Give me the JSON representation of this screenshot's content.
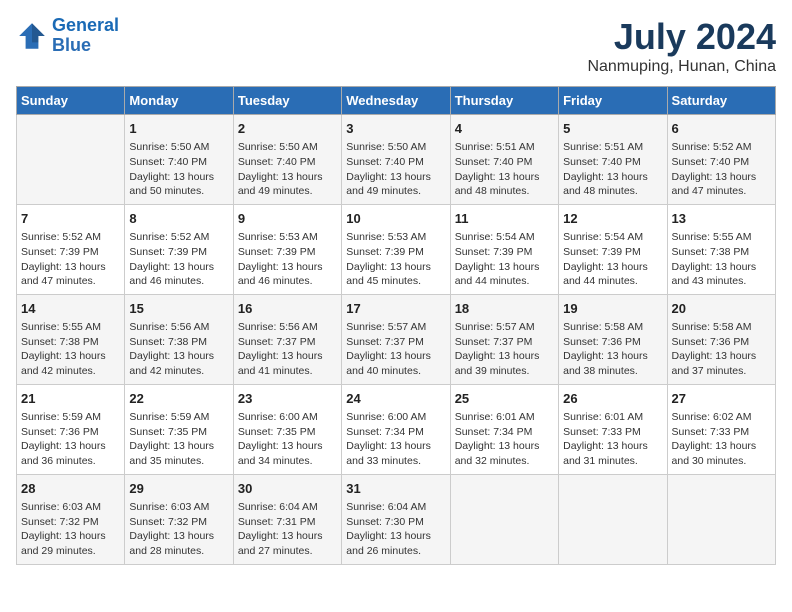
{
  "logo": {
    "text_general": "General",
    "text_blue": "Blue"
  },
  "title": "July 2024",
  "subtitle": "Nanmuping, Hunan, China",
  "days_header": [
    "Sunday",
    "Monday",
    "Tuesday",
    "Wednesday",
    "Thursday",
    "Friday",
    "Saturday"
  ],
  "weeks": [
    [
      {
        "day": "",
        "text": ""
      },
      {
        "day": "1",
        "text": "Sunrise: 5:50 AM\nSunset: 7:40 PM\nDaylight: 13 hours\nand 50 minutes."
      },
      {
        "day": "2",
        "text": "Sunrise: 5:50 AM\nSunset: 7:40 PM\nDaylight: 13 hours\nand 49 minutes."
      },
      {
        "day": "3",
        "text": "Sunrise: 5:50 AM\nSunset: 7:40 PM\nDaylight: 13 hours\nand 49 minutes."
      },
      {
        "day": "4",
        "text": "Sunrise: 5:51 AM\nSunset: 7:40 PM\nDaylight: 13 hours\nand 48 minutes."
      },
      {
        "day": "5",
        "text": "Sunrise: 5:51 AM\nSunset: 7:40 PM\nDaylight: 13 hours\nand 48 minutes."
      },
      {
        "day": "6",
        "text": "Sunrise: 5:52 AM\nSunset: 7:40 PM\nDaylight: 13 hours\nand 47 minutes."
      }
    ],
    [
      {
        "day": "7",
        "text": "Sunrise: 5:52 AM\nSunset: 7:39 PM\nDaylight: 13 hours\nand 47 minutes."
      },
      {
        "day": "8",
        "text": "Sunrise: 5:52 AM\nSunset: 7:39 PM\nDaylight: 13 hours\nand 46 minutes."
      },
      {
        "day": "9",
        "text": "Sunrise: 5:53 AM\nSunset: 7:39 PM\nDaylight: 13 hours\nand 46 minutes."
      },
      {
        "day": "10",
        "text": "Sunrise: 5:53 AM\nSunset: 7:39 PM\nDaylight: 13 hours\nand 45 minutes."
      },
      {
        "day": "11",
        "text": "Sunrise: 5:54 AM\nSunset: 7:39 PM\nDaylight: 13 hours\nand 44 minutes."
      },
      {
        "day": "12",
        "text": "Sunrise: 5:54 AM\nSunset: 7:39 PM\nDaylight: 13 hours\nand 44 minutes."
      },
      {
        "day": "13",
        "text": "Sunrise: 5:55 AM\nSunset: 7:38 PM\nDaylight: 13 hours\nand 43 minutes."
      }
    ],
    [
      {
        "day": "14",
        "text": "Sunrise: 5:55 AM\nSunset: 7:38 PM\nDaylight: 13 hours\nand 42 minutes."
      },
      {
        "day": "15",
        "text": "Sunrise: 5:56 AM\nSunset: 7:38 PM\nDaylight: 13 hours\nand 42 minutes."
      },
      {
        "day": "16",
        "text": "Sunrise: 5:56 AM\nSunset: 7:37 PM\nDaylight: 13 hours\nand 41 minutes."
      },
      {
        "day": "17",
        "text": "Sunrise: 5:57 AM\nSunset: 7:37 PM\nDaylight: 13 hours\nand 40 minutes."
      },
      {
        "day": "18",
        "text": "Sunrise: 5:57 AM\nSunset: 7:37 PM\nDaylight: 13 hours\nand 39 minutes."
      },
      {
        "day": "19",
        "text": "Sunrise: 5:58 AM\nSunset: 7:36 PM\nDaylight: 13 hours\nand 38 minutes."
      },
      {
        "day": "20",
        "text": "Sunrise: 5:58 AM\nSunset: 7:36 PM\nDaylight: 13 hours\nand 37 minutes."
      }
    ],
    [
      {
        "day": "21",
        "text": "Sunrise: 5:59 AM\nSunset: 7:36 PM\nDaylight: 13 hours\nand 36 minutes."
      },
      {
        "day": "22",
        "text": "Sunrise: 5:59 AM\nSunset: 7:35 PM\nDaylight: 13 hours\nand 35 minutes."
      },
      {
        "day": "23",
        "text": "Sunrise: 6:00 AM\nSunset: 7:35 PM\nDaylight: 13 hours\nand 34 minutes."
      },
      {
        "day": "24",
        "text": "Sunrise: 6:00 AM\nSunset: 7:34 PM\nDaylight: 13 hours\nand 33 minutes."
      },
      {
        "day": "25",
        "text": "Sunrise: 6:01 AM\nSunset: 7:34 PM\nDaylight: 13 hours\nand 32 minutes."
      },
      {
        "day": "26",
        "text": "Sunrise: 6:01 AM\nSunset: 7:33 PM\nDaylight: 13 hours\nand 31 minutes."
      },
      {
        "day": "27",
        "text": "Sunrise: 6:02 AM\nSunset: 7:33 PM\nDaylight: 13 hours\nand 30 minutes."
      }
    ],
    [
      {
        "day": "28",
        "text": "Sunrise: 6:03 AM\nSunset: 7:32 PM\nDaylight: 13 hours\nand 29 minutes."
      },
      {
        "day": "29",
        "text": "Sunrise: 6:03 AM\nSunset: 7:32 PM\nDaylight: 13 hours\nand 28 minutes."
      },
      {
        "day": "30",
        "text": "Sunrise: 6:04 AM\nSunset: 7:31 PM\nDaylight: 13 hours\nand 27 minutes."
      },
      {
        "day": "31",
        "text": "Sunrise: 6:04 AM\nSunset: 7:30 PM\nDaylight: 13 hours\nand 26 minutes."
      },
      {
        "day": "",
        "text": ""
      },
      {
        "day": "",
        "text": ""
      },
      {
        "day": "",
        "text": ""
      }
    ]
  ]
}
